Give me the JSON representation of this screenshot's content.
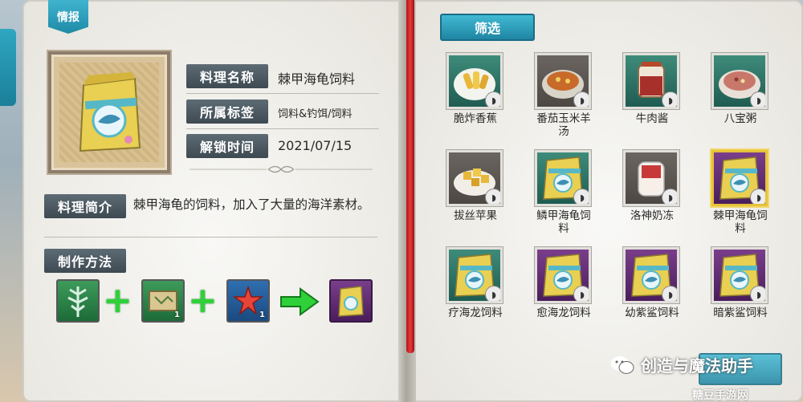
{
  "header": {
    "intel_tab": "情报",
    "filter_button": "筛选"
  },
  "info": {
    "fields": [
      {
        "label": "料理名称",
        "value": "棘甲海龟饲料"
      },
      {
        "label": "所属标签",
        "value": "饲料&钓饵/饲料"
      },
      {
        "label": "解锁时间",
        "value": "2021/07/15"
      }
    ],
    "description_label": "料理简介",
    "description": "棘甲海龟的饲料，加入了大量的海洋素材。",
    "method_label": "制作方法"
  },
  "recipe": [
    {
      "icon": "seaweed-icon",
      "count": ""
    },
    {
      "icon": "map-scroll-icon",
      "count": "1"
    },
    {
      "icon": "starfish-icon",
      "count": "1"
    }
  ],
  "dishes": [
    {
      "name": "脆炸香蕉",
      "icon": "fried-banana-icon",
      "frame": "teal"
    },
    {
      "name": "番茄玉米羊汤",
      "icon": "soup-bowl-icon",
      "frame": "brown"
    },
    {
      "name": "牛肉酱",
      "icon": "sauce-jar-icon",
      "frame": "teal"
    },
    {
      "name": "八宝粥",
      "icon": "porridge-bowl-icon",
      "frame": "teal"
    },
    {
      "name": "拔丝苹果",
      "icon": "candied-apple-icon",
      "frame": "brown"
    },
    {
      "name": "鳞甲海龟饲料",
      "icon": "feed-bag-icon",
      "frame": "teal"
    },
    {
      "name": "洛神奶冻",
      "icon": "pudding-cup-icon",
      "frame": "brown"
    },
    {
      "name": "棘甲海龟饲料",
      "icon": "feed-bag-icon",
      "frame": "purple",
      "selected": true
    },
    {
      "name": "疗海龙饲料",
      "icon": "feed-bag-icon",
      "frame": "teal"
    },
    {
      "name": "愈海龙饲料",
      "icon": "feed-bag-icon",
      "frame": "purple"
    },
    {
      "name": "幼紫鲨饲料",
      "icon": "feed-bag-icon",
      "frame": "purple"
    },
    {
      "name": "暗紫鲨饲料",
      "icon": "feed-bag-icon",
      "frame": "purple"
    }
  ],
  "watermark": {
    "text": "创造与魔法助手",
    "sub": "糖豆手游网"
  },
  "colors": {
    "accent": "#1e86a3",
    "ribbon": "#d42a2a",
    "plus": "#2fd13a"
  }
}
